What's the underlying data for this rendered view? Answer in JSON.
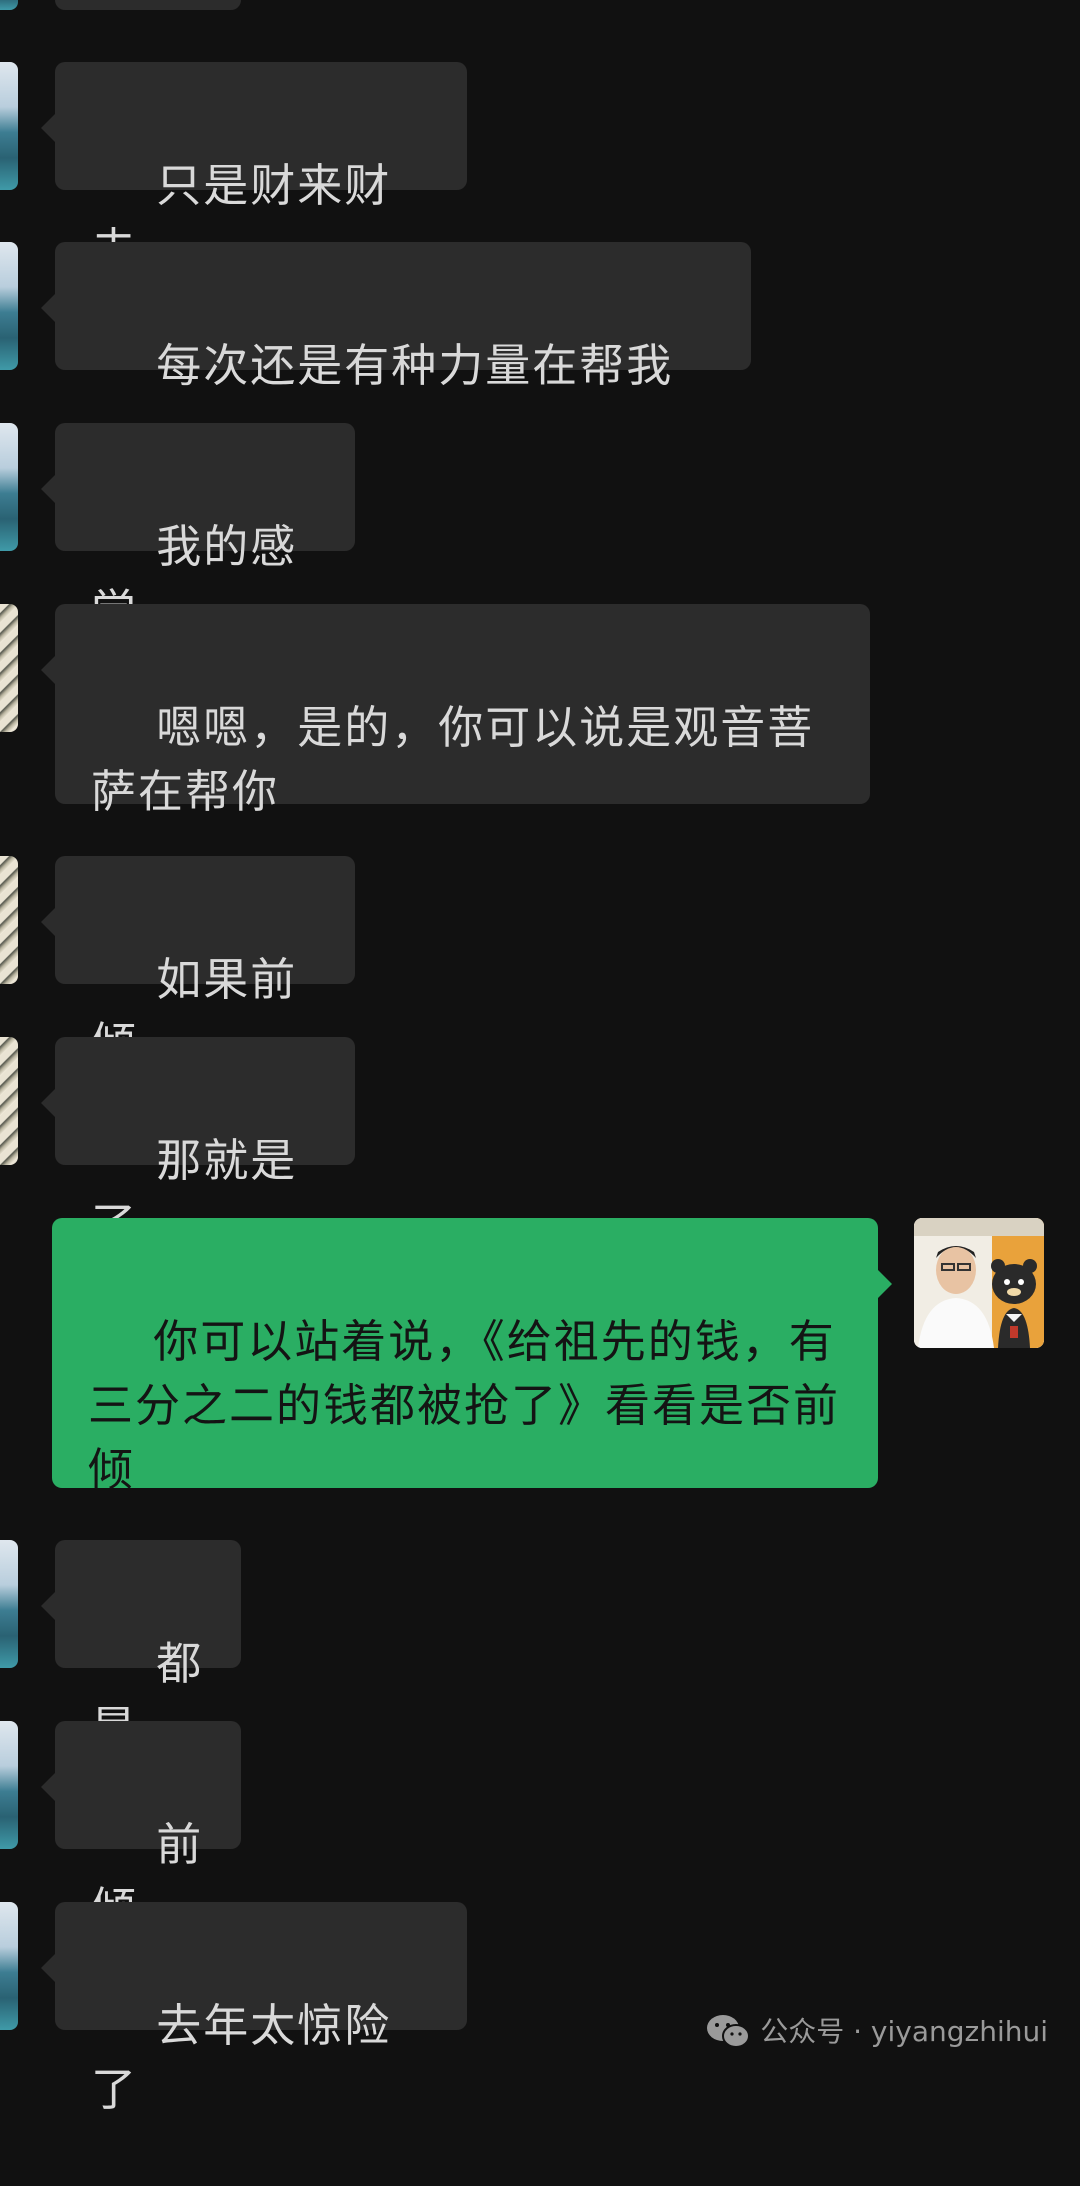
{
  "messages": [
    {
      "side": "left",
      "avatar": "sea-avatar",
      "text": "只是财来财去"
    },
    {
      "side": "left",
      "avatar": "sea-avatar",
      "text": "每次还是有种力量在帮我"
    },
    {
      "side": "left",
      "avatar": "sea-avatar",
      "text": "我的感觉"
    },
    {
      "side": "left",
      "avatar": "art-avatar",
      "text": "嗯嗯，是的，你可以说是观音菩萨在帮你"
    },
    {
      "side": "left",
      "avatar": "art-avatar",
      "text": "如果前倾"
    },
    {
      "side": "left",
      "avatar": "art-avatar",
      "text": "那就是了"
    },
    {
      "side": "right",
      "avatar": "user-photo-avatar",
      "text": "你可以站着说，《给祖先的钱，有三分之二的钱都被抢了》看看是否前倾"
    },
    {
      "side": "left",
      "avatar": "sea-avatar",
      "text": "都是"
    },
    {
      "side": "left",
      "avatar": "sea-avatar",
      "text": "前倾"
    },
    {
      "side": "left",
      "avatar": "sea-avatar",
      "text": "去年太惊险了"
    }
  ],
  "watermark": {
    "icon": "wechat-icon",
    "text": "公众号 · yiyangzhihui"
  },
  "colors": {
    "background": "#111111",
    "incoming_bubble": "#2c2c2c",
    "outgoing_bubble": "#2aae63"
  }
}
